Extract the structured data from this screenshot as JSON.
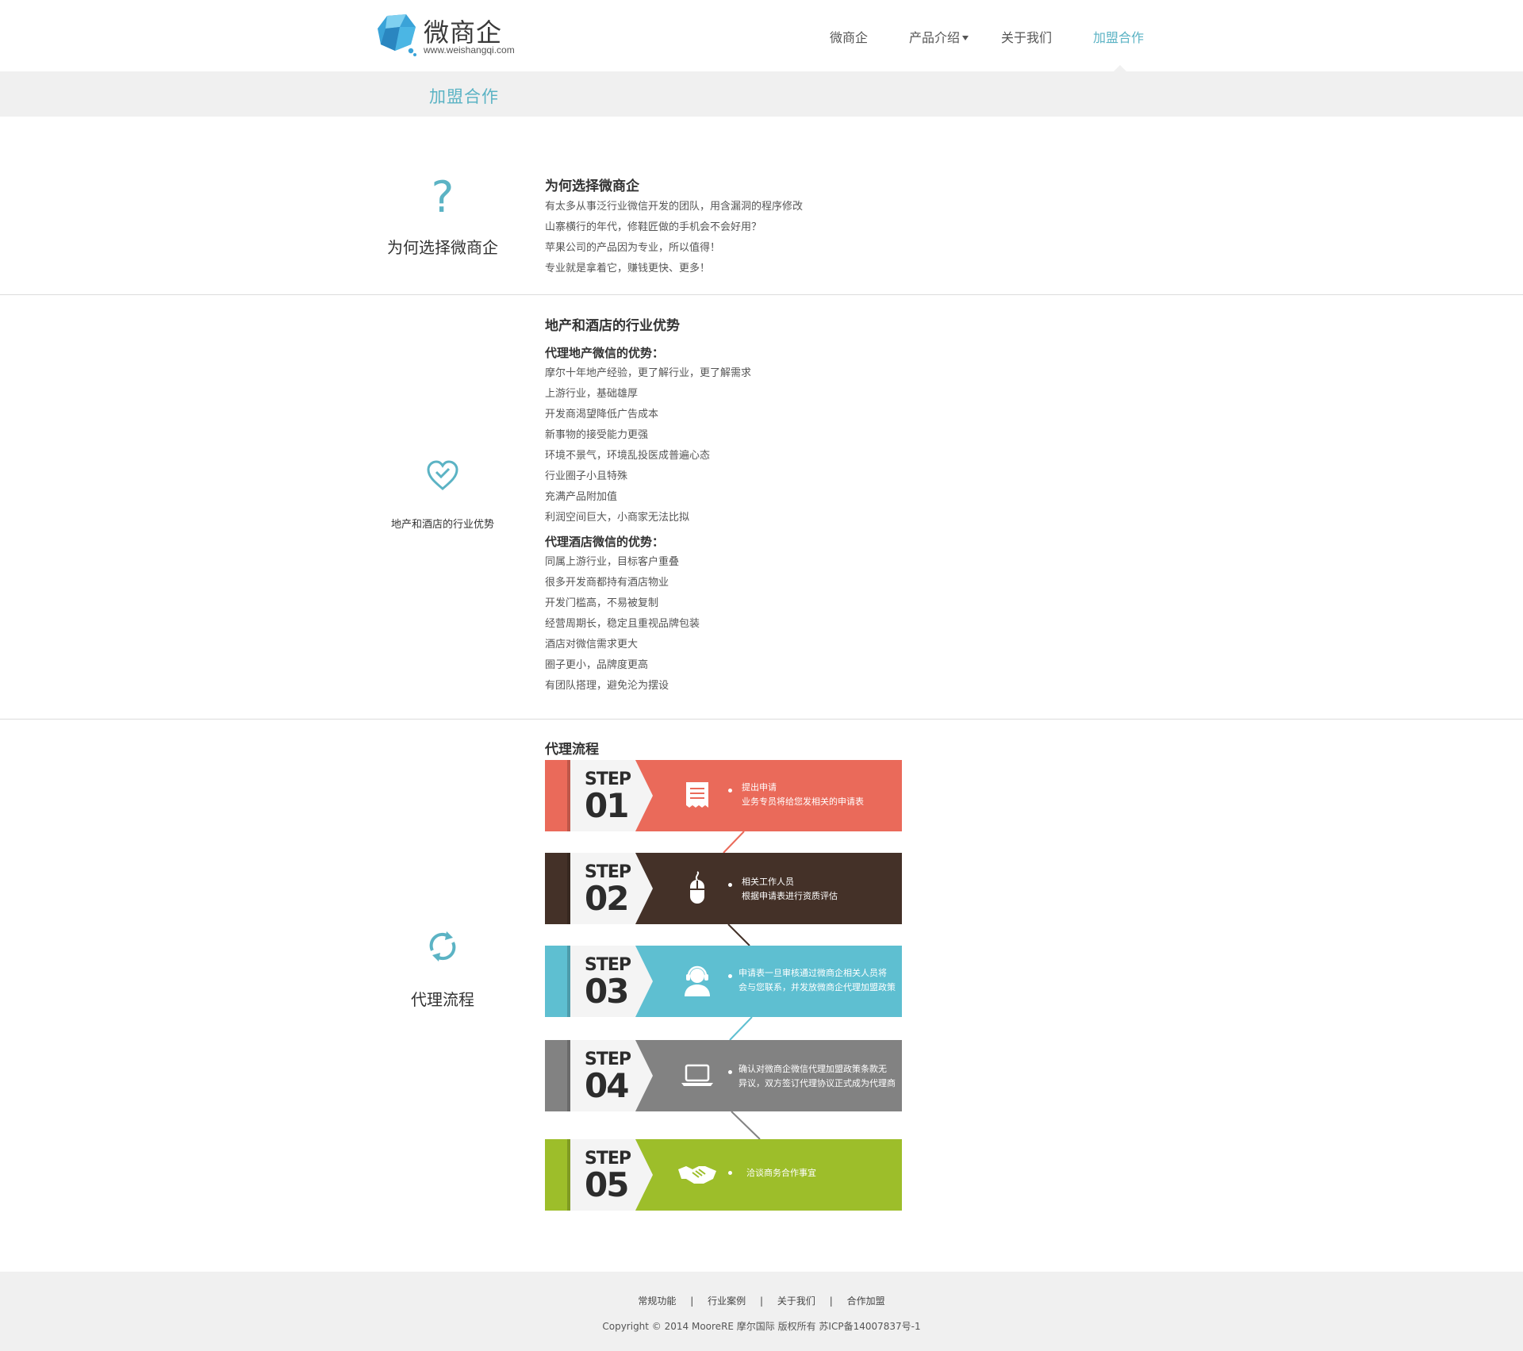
{
  "header": {
    "logo_name": "微商企",
    "logo_url": "www.weishangqi.com",
    "nav": [
      {
        "label": "微商企"
      },
      {
        "label": "产品介绍"
      },
      {
        "label": "关于我们"
      },
      {
        "label": "加盟合作"
      }
    ]
  },
  "banner": {
    "title": "加盟合作"
  },
  "why": {
    "icon": "?",
    "label": "为何选择微商企",
    "title": "为何选择微商企",
    "lines": [
      "有太多从事泛行业微信开发的团队，用含漏洞的程序修改",
      "山寨横行的年代，修鞋匠做的手机会不会好用？",
      "苹果公司的产品因为专业，所以值得！",
      "专业就是拿着它，赚钱更快、更多！"
    ]
  },
  "advantage": {
    "label": "地产和酒店的行业优势",
    "title": "地产和酒店的行业优势",
    "estate_title": "代理地产微信的优势：",
    "estate_lines": [
      "摩尔十年地产经验，更了解行业，更了解需求",
      "上游行业，基础雄厚",
      "开发商渴望降低广告成本",
      "新事物的接受能力更强",
      "环境不景气，环境乱投医成普遍心态",
      "行业圈子小且特殊",
      "充满产品附加值",
      "利润空间巨大，小商家无法比拟"
    ],
    "hotel_title": "代理酒店微信的优势：",
    "hotel_lines": [
      "同属上游行业，目标客户重叠",
      "很多开发商都持有酒店物业",
      "开发门槛高，不易被复制",
      "经营周期长，稳定且重视品牌包装",
      "酒店对微信需求更大",
      "圈子更小，品牌度更高",
      "有团队搭理，避免沦为摆设"
    ]
  },
  "process": {
    "label": "代理流程",
    "title": "代理流程",
    "steps": [
      {
        "word": "STEP",
        "num": "01",
        "color": "#ea6a5a",
        "icon": "document-icon",
        "lines": [
          "提出申请",
          "业务专员将给您发相关的申请表"
        ]
      },
      {
        "word": "STEP",
        "num": "02",
        "color": "#443128",
        "icon": "mouse-icon",
        "lines": [
          "相关工作人员",
          "根据申请表进行资质评估"
        ]
      },
      {
        "word": "STEP",
        "num": "03",
        "color": "#5ebfd1",
        "icon": "support-agent-icon",
        "lines": [
          "申请表一旦审核通过微商企相关人员将",
          "会与您联系，并发放微商企代理加盟政策"
        ]
      },
      {
        "word": "STEP",
        "num": "04",
        "color": "#828282",
        "icon": "laptop-icon",
        "lines": [
          "确认对微商企微信代理加盟政策条款无",
          "异议，双方签订代理协议正式成为代理商"
        ]
      },
      {
        "word": "STEP",
        "num": "05",
        "color": "#9dbe2a",
        "icon": "handshake-icon",
        "lines": [
          "洽谈商务合作事宜"
        ]
      }
    ]
  },
  "footer": {
    "links": [
      "常规功能",
      "行业案例",
      "关于我们",
      "合作加盟"
    ],
    "separator": "|",
    "copyright": "Copyright © 2014  MooreRE 摩尔国际  版权所有 苏ICP备14007837号-1"
  }
}
